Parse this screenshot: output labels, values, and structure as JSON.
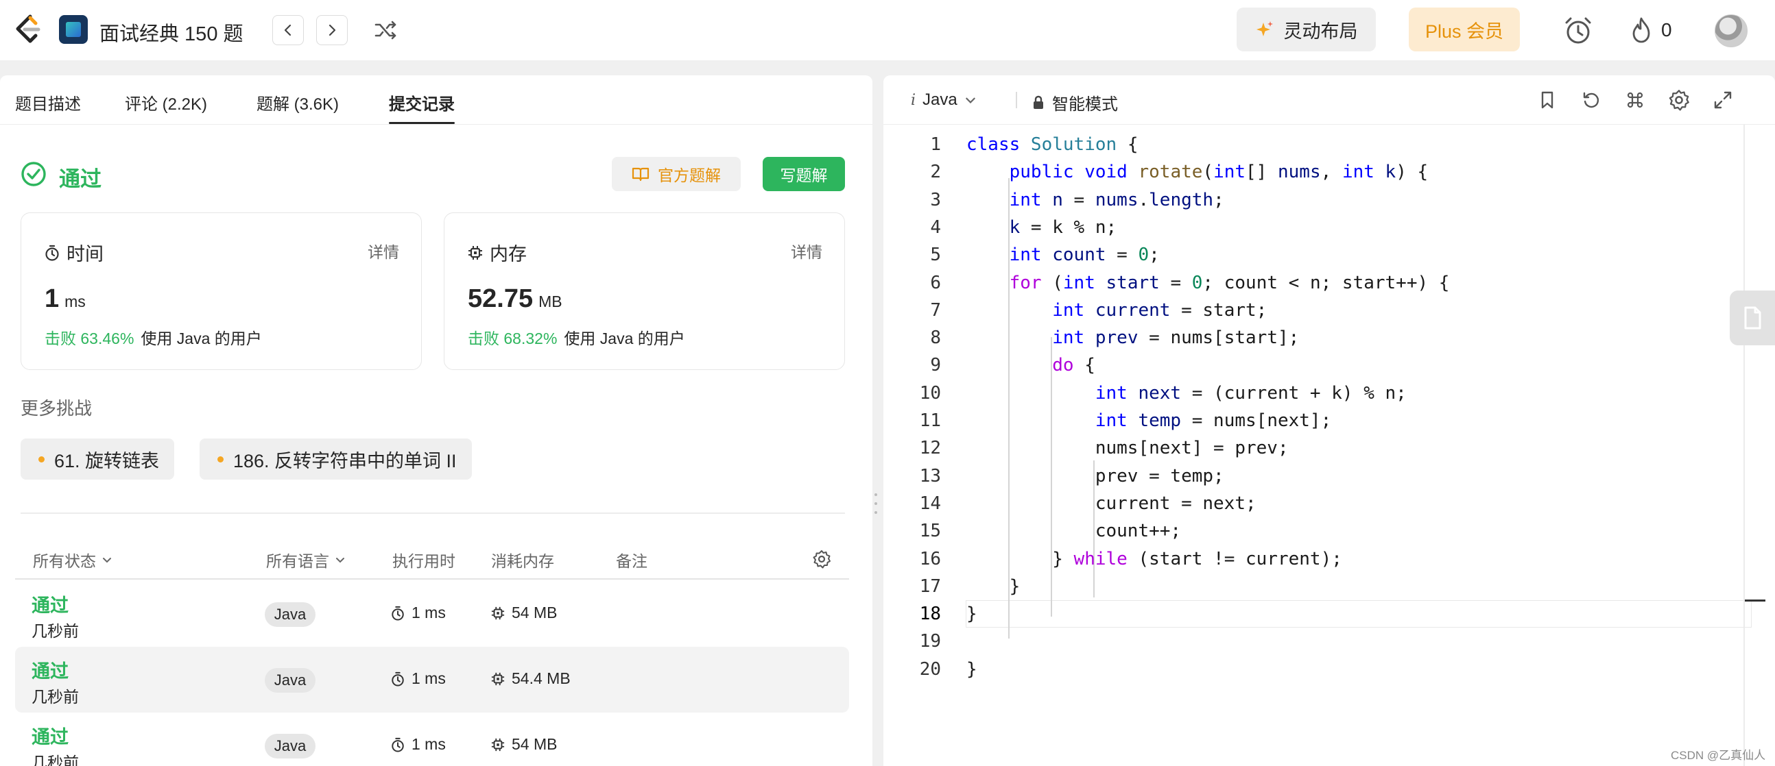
{
  "topbar": {
    "course_title": "面试经典 150 题",
    "ai_button": "灵动布局",
    "plus_button": "Plus 会员",
    "fire_count": "0",
    "colors": {
      "plus_text": "#e6920b",
      "plus_bg": "#fdebd0"
    }
  },
  "tabs": [
    {
      "label": "题目描述"
    },
    {
      "label": "评论 (2.2K)"
    },
    {
      "label": "题解 (3.6K)"
    },
    {
      "label": "提交记录"
    }
  ],
  "result": {
    "status": "通过",
    "official_solution": "官方题解",
    "write_solution": "写题解",
    "colors": {
      "pass": "#2db55d",
      "official": "#e6920b"
    }
  },
  "stats": {
    "time": {
      "label": "时间",
      "detail": "详情",
      "value": "1",
      "unit": "ms",
      "beat_pct": "击败 63.46%",
      "beat_text": "使用 Java 的用户"
    },
    "memory": {
      "label": "内存",
      "detail": "详情",
      "value": "52.75",
      "unit": "MB",
      "beat_pct": "击败 68.32%",
      "beat_text": "使用 Java 的用户"
    }
  },
  "more": {
    "title": "更多挑战",
    "items": [
      {
        "label": "61. 旋转链表"
      },
      {
        "label": "186. 反转字符串中的单词 II"
      }
    ]
  },
  "table": {
    "headers": {
      "status": "所有状态",
      "lang": "所有语言",
      "runtime": "执行用时",
      "memory": "消耗内存",
      "note": "备注"
    },
    "rows": [
      {
        "status": "通过",
        "time": "几秒前",
        "lang": "Java",
        "runtime": "1 ms",
        "memory": "54 MB"
      },
      {
        "status": "通过",
        "time": "几秒前",
        "lang": "Java",
        "runtime": "1 ms",
        "memory": "54.4 MB"
      },
      {
        "status": "通过",
        "time": "几秒前",
        "lang": "Java",
        "runtime": "1 ms",
        "memory": "54 MB"
      }
    ]
  },
  "editor": {
    "language": "Java",
    "mode": "智能模式",
    "current_line": 18,
    "lines": [
      [
        [
          "kw",
          "class"
        ],
        [
          "",
          ""
        ],
        [
          "tp",
          " Solution"
        ],
        [
          "",
          " {"
        ]
      ],
      [
        [
          "",
          "    "
        ],
        [
          "kw",
          "public"
        ],
        [
          "kw",
          " void"
        ],
        [
          "fn",
          " rotate"
        ],
        [
          "",
          "("
        ],
        [
          "kw",
          "int"
        ],
        [
          "",
          "[] "
        ],
        [
          "vr",
          "nums"
        ],
        [
          "",
          ", "
        ],
        [
          "kw",
          "int"
        ],
        [
          "vr",
          " k"
        ],
        [
          "",
          ") {"
        ]
      ],
      [
        [
          "",
          "    "
        ],
        [
          "kw",
          "int"
        ],
        [
          "vr",
          " n"
        ],
        [
          "",
          " = "
        ],
        [
          "vr",
          "nums"
        ],
        [
          "",
          "."
        ],
        [
          "vr",
          "length"
        ],
        [
          "",
          ";"
        ]
      ],
      [
        [
          "",
          "    "
        ],
        [
          "vr",
          "k"
        ],
        [
          "",
          " = k % n;"
        ]
      ],
      [
        [
          "",
          "    "
        ],
        [
          "kw",
          "int"
        ],
        [
          "vr",
          " count"
        ],
        [
          "",
          " = "
        ],
        [
          "nm",
          "0"
        ],
        [
          "",
          ";"
        ]
      ],
      [
        [
          "",
          "    "
        ],
        [
          "kw2",
          "for"
        ],
        [
          "",
          " ("
        ],
        [
          "kw",
          "int"
        ],
        [
          "vr",
          " start"
        ],
        [
          "",
          " = "
        ],
        [
          "nm",
          "0"
        ],
        [
          "",
          "; count < n; start++) {"
        ]
      ],
      [
        [
          "",
          "        "
        ],
        [
          "kw",
          "int"
        ],
        [
          "vr",
          " current"
        ],
        [
          "",
          " = start;"
        ]
      ],
      [
        [
          "",
          "        "
        ],
        [
          "kw",
          "int"
        ],
        [
          "vr",
          " prev"
        ],
        [
          "",
          " = nums[start];"
        ]
      ],
      [
        [
          "",
          "        "
        ],
        [
          "kw2",
          "do"
        ],
        [
          "",
          " {"
        ]
      ],
      [
        [
          "",
          "            "
        ],
        [
          "kw",
          "int"
        ],
        [
          "vr",
          " next"
        ],
        [
          "",
          " = (current + k) % n;"
        ]
      ],
      [
        [
          "",
          "            "
        ],
        [
          "kw",
          "int"
        ],
        [
          "vr",
          " temp"
        ],
        [
          "",
          " = nums[next];"
        ]
      ],
      [
        [
          "",
          "            nums[next] = prev;"
        ]
      ],
      [
        [
          "",
          "            prev = temp;"
        ]
      ],
      [
        [
          "",
          "            current = next;"
        ]
      ],
      [
        [
          "",
          "            count++;"
        ]
      ],
      [
        [
          "",
          "        } "
        ],
        [
          "kw2",
          "while"
        ],
        [
          "",
          " (start != current);"
        ]
      ],
      [
        [
          "",
          "    }"
        ]
      ],
      [
        [
          "",
          "}"
        ]
      ],
      [
        [
          "",
          ""
        ]
      ],
      [
        [
          "",
          "}"
        ]
      ]
    ]
  },
  "watermark": "CSDN @乙真仙人"
}
